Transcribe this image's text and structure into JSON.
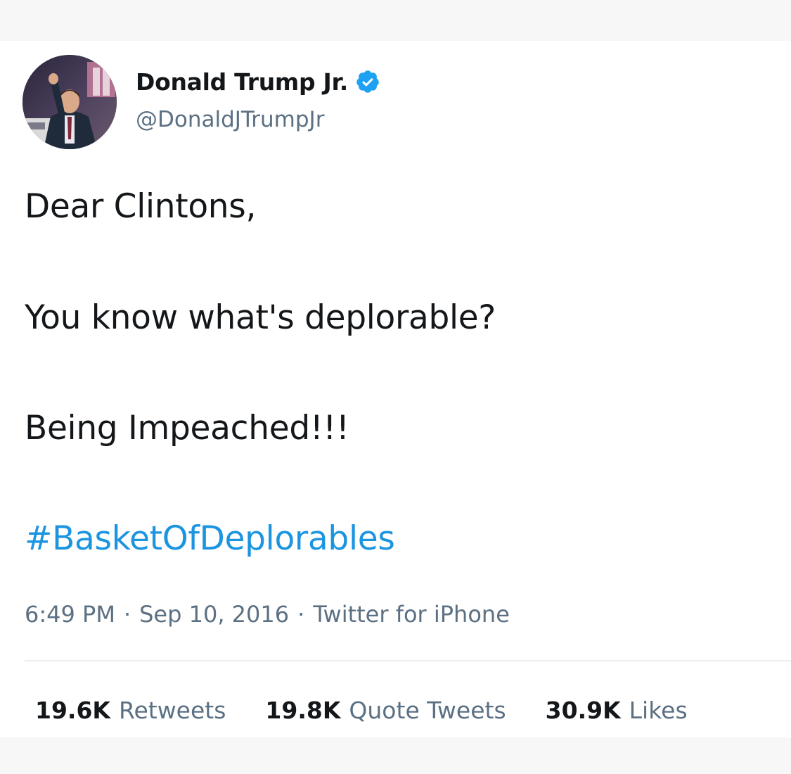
{
  "tweet": {
    "author": {
      "display_name": "Donald Trump Jr.",
      "handle": "@DonaldJTrumpJr",
      "verified": true,
      "avatar_icon": "profile-photo"
    },
    "lines": [
      "Dear Clintons,",
      "You know what's deplorable?",
      "Being Impeached!!!"
    ],
    "hashtag": "#BasketOfDeplorables",
    "meta": {
      "time": "6:49 PM",
      "separator": "·",
      "date": "Sep 10, 2016",
      "source": "Twitter for iPhone"
    },
    "stats": {
      "retweets": {
        "count": "19.6K",
        "label": "Retweets"
      },
      "quote_tweets": {
        "count": "19.8K",
        "label": "Quote Tweets"
      },
      "likes": {
        "count": "30.9K",
        "label": "Likes"
      }
    }
  },
  "colors": {
    "text_primary": "#14171a",
    "text_secondary": "#5b7083",
    "link_blue": "#1b95e0",
    "verified_blue": "#1da1f2",
    "divider": "#ebeef0",
    "background": "#f7f7f7"
  }
}
